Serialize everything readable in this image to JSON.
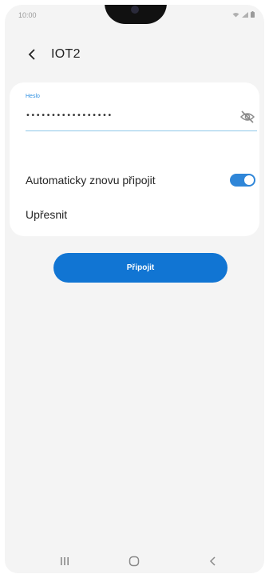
{
  "status_bar": {
    "time": "10:00"
  },
  "app_bar": {
    "title": "IOT2",
    "back_icon": "chevron-left-icon"
  },
  "password": {
    "label": "Heslo",
    "value": "•••••••••••••••••",
    "visibility_icon": "eye-off-icon"
  },
  "settings": {
    "auto_reconnect_label": "Automaticky znovu připojit",
    "auto_reconnect_enabled": true,
    "advanced_label": "Upřesnit"
  },
  "actions": {
    "connect_label": "Připojit"
  },
  "nav_bar": {
    "recents_icon": "recent-apps-icon",
    "home_icon": "home-icon",
    "back_icon": "back-icon"
  },
  "colors": {
    "accent": "#1175d3",
    "switch_on": "#2f86d8",
    "background": "#f4f4f4",
    "card": "#ffffff"
  }
}
